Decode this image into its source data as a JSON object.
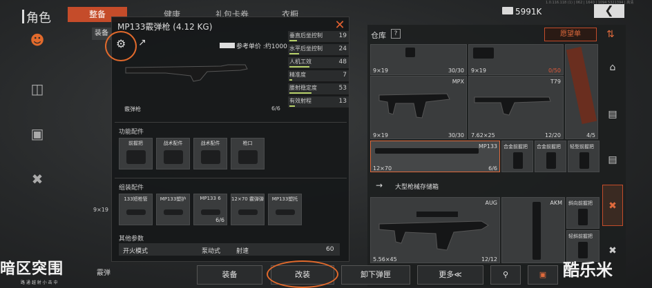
{
  "header": {
    "title": "角色",
    "tabs": [
      "整备",
      "健康",
      "礼包卡券",
      "衣橱"
    ],
    "active_tab": "整备",
    "money": "5991K",
    "back_icon": "chevron-left-icon",
    "version": "1.0.116.118 (1) | 062 | 1640 | 1094 5321394 | 高清"
  },
  "left_sidebar": {
    "icons": [
      "character-icon",
      "backpack-icon",
      "bag-icon",
      "weapon-icon"
    ],
    "partial_texts": [
      "装备",
      "9×19",
      "霰弹"
    ]
  },
  "detail": {
    "title": "MP133霰弹枪 (4.12 KG)",
    "ref_price_label": "参考单价 :约1000",
    "weapon_type": "霰弹枪",
    "ammo_count": "6/6",
    "stats": [
      {
        "label": "垂直后坐控制",
        "value": "19",
        "fill": 0.19
      },
      {
        "label": "水平后坐控制",
        "value": "24",
        "fill": 0.24
      },
      {
        "label": "人机工效",
        "value": "48",
        "fill": 0.48
      },
      {
        "label": "精准度",
        "value": "7",
        "fill": 0.07
      },
      {
        "label": "腰射稳定度",
        "value": "53",
        "fill": 0.53
      },
      {
        "label": "有效射程",
        "value": "13",
        "fill": 0.13
      }
    ],
    "func_section": "功能配件",
    "func_slots": [
      "前握把",
      "战术配件",
      "战术配件",
      "枪口"
    ],
    "assembly_section": "组装配件",
    "assembly_slots": [
      {
        "label": "133短枪管",
        "count": ""
      },
      {
        "label": "MP133塑护",
        "count": ""
      },
      {
        "label": "MP133 6",
        "count": "6/6"
      },
      {
        "label": "12×70 霰弹弹",
        "count": ""
      },
      {
        "label": "MP133塑托",
        "count": ""
      }
    ],
    "other_section": "其他参数",
    "fire_mode_label": "开火模式",
    "fire_mode_value": "泵动式",
    "rate_label": "射速",
    "rate_value": "60"
  },
  "warehouse": {
    "title": "仓库",
    "help": "?",
    "wishlist": "愿望单",
    "items": [
      {
        "name": "",
        "ammo": "9×19",
        "count": "30/30"
      },
      {
        "name": "",
        "ammo": "9×19",
        "count": "0/50"
      },
      {
        "name": "MPX",
        "ammo": "9×19",
        "count": "30/30"
      },
      {
        "name": "T79",
        "ammo": "7.62×25",
        "count": "12/20"
      },
      {
        "name": "",
        "ammo": "",
        "count": "4/5"
      },
      {
        "name": "MP133",
        "ammo": "12×70",
        "count": "6/6"
      },
      {
        "name": "合金前握把",
        "ammo": "",
        "count": ""
      },
      {
        "name": "合金前握把",
        "ammo": "",
        "count": ""
      },
      {
        "name": "轻型前握把",
        "ammo": "",
        "count": ""
      },
      {
        "name": "AUG",
        "ammo": "5.56×45",
        "count": "12/12"
      },
      {
        "name": "AKM",
        "ammo": "",
        "count": ""
      },
      {
        "name": "斜向前握把",
        "ammo": "",
        "count": ""
      },
      {
        "name": "轻斜前握把",
        "ammo": "",
        "count": ""
      }
    ],
    "storage_label": "大型枪械存储箱"
  },
  "bottom": {
    "buttons": [
      "装备",
      "改装",
      "卸下弹匣",
      "更多≪"
    ],
    "search_icon": "search-icon",
    "watermark_left": "暗区突围",
    "watermark_sub": "路 通 越 射 小 击 中",
    "watermark_right": "酷乐米"
  },
  "colors": {
    "accent": "#c54c2a",
    "stat_bar": "#b9d36a",
    "highlight_circle": "#e26a2c"
  }
}
